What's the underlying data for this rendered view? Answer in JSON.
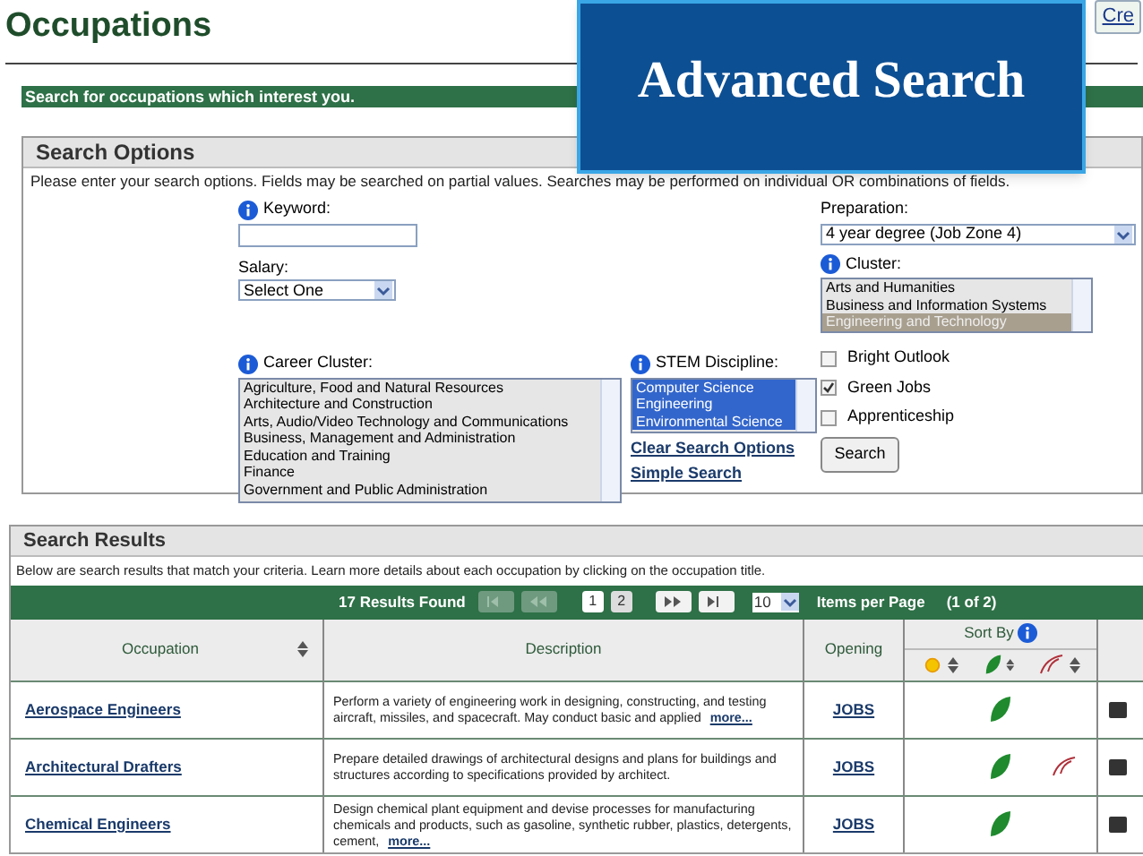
{
  "page_title": "Occupations",
  "top_button": "Cre",
  "banner": "Advanced Search",
  "intro_bar": "Search for occupations which interest you.",
  "search_options": {
    "title": "Search Options",
    "instructions": "Please enter your search options. Fields may be searched on partial values. Searches may be performed on individual OR combinations of fields.",
    "keyword": {
      "label": "Keyword:"
    },
    "salary": {
      "label": "Salary:",
      "value": "Select One"
    },
    "preparation": {
      "label": "Preparation:",
      "value": "4 year degree (Job Zone 4)"
    },
    "cluster": {
      "label": "Cluster:",
      "items": [
        {
          "label": "Arts and Humanities",
          "selected": false
        },
        {
          "label": "Business and Information Systems",
          "selected": false
        },
        {
          "label": "Engineering and Technology",
          "selected": true
        }
      ]
    },
    "career_cluster": {
      "label": "Career Cluster:",
      "items": [
        {
          "label": "Agriculture, Food and Natural Resources",
          "selected": false
        },
        {
          "label": "Architecture and Construction",
          "selected": false
        },
        {
          "label": "Arts, Audio/Video Technology and Communications",
          "selected": false
        },
        {
          "label": "Business, Management and Administration",
          "selected": false
        },
        {
          "label": "Education and Training",
          "selected": false
        },
        {
          "label": "Finance",
          "selected": false
        },
        {
          "label": "Government and Public Administration",
          "selected": false
        }
      ]
    },
    "stem": {
      "label": "STEM Discipline:",
      "items": [
        {
          "label": "Computer Science",
          "selected": true
        },
        {
          "label": "Engineering",
          "selected": true
        },
        {
          "label": "Environmental Science",
          "selected": true
        }
      ]
    },
    "links": [
      "Clear Search Options",
      "Simple Search"
    ],
    "checkboxes": [
      {
        "label": "Bright Outlook",
        "checked": false
      },
      {
        "label": "Green Jobs",
        "checked": true
      },
      {
        "label": "Apprenticeship",
        "checked": false
      }
    ],
    "search_button": "Search"
  },
  "search_results": {
    "title": "Search Results",
    "instructions": "Below are search results that match your criteria. Learn more details about each occupation by clicking on the occupation title.",
    "results_found": "17 Results Found",
    "pages": [
      {
        "label": "1",
        "selected": true
      },
      {
        "label": "2",
        "selected": false
      }
    ],
    "per_page": "10",
    "per_page_label": "Items per Page",
    "page_status": "(1 of 2)",
    "columns": [
      "Occupation",
      "Description",
      "Opening",
      "Sort By"
    ],
    "rows": [
      {
        "occupation": "Aerospace Engineers",
        "description": "Perform a variety of engineering work in designing, constructing, and testing aircraft, missiles, and spacecraft. May conduct basic and applied",
        "more": "more...",
        "opening": "JOBS",
        "bright_outlook": false,
        "green": true,
        "apprenticeship": false
      },
      {
        "occupation": "Architectural Drafters",
        "description": "Prepare detailed drawings of architectural designs and plans for buildings and structures according to specifications provided by architect.",
        "opening": "JOBS",
        "bright_outlook": false,
        "green": true,
        "apprenticeship": true
      },
      {
        "occupation": "Chemical Engineers",
        "description": "Design chemical plant equipment and devise processes for manufacturing chemicals and products, such as gasoline, synthetic rubber, plastics, detergents, cement,",
        "more": "more...",
        "opening": "JOBS",
        "bright_outlook": false,
        "green": true,
        "apprenticeship": false
      }
    ]
  }
}
